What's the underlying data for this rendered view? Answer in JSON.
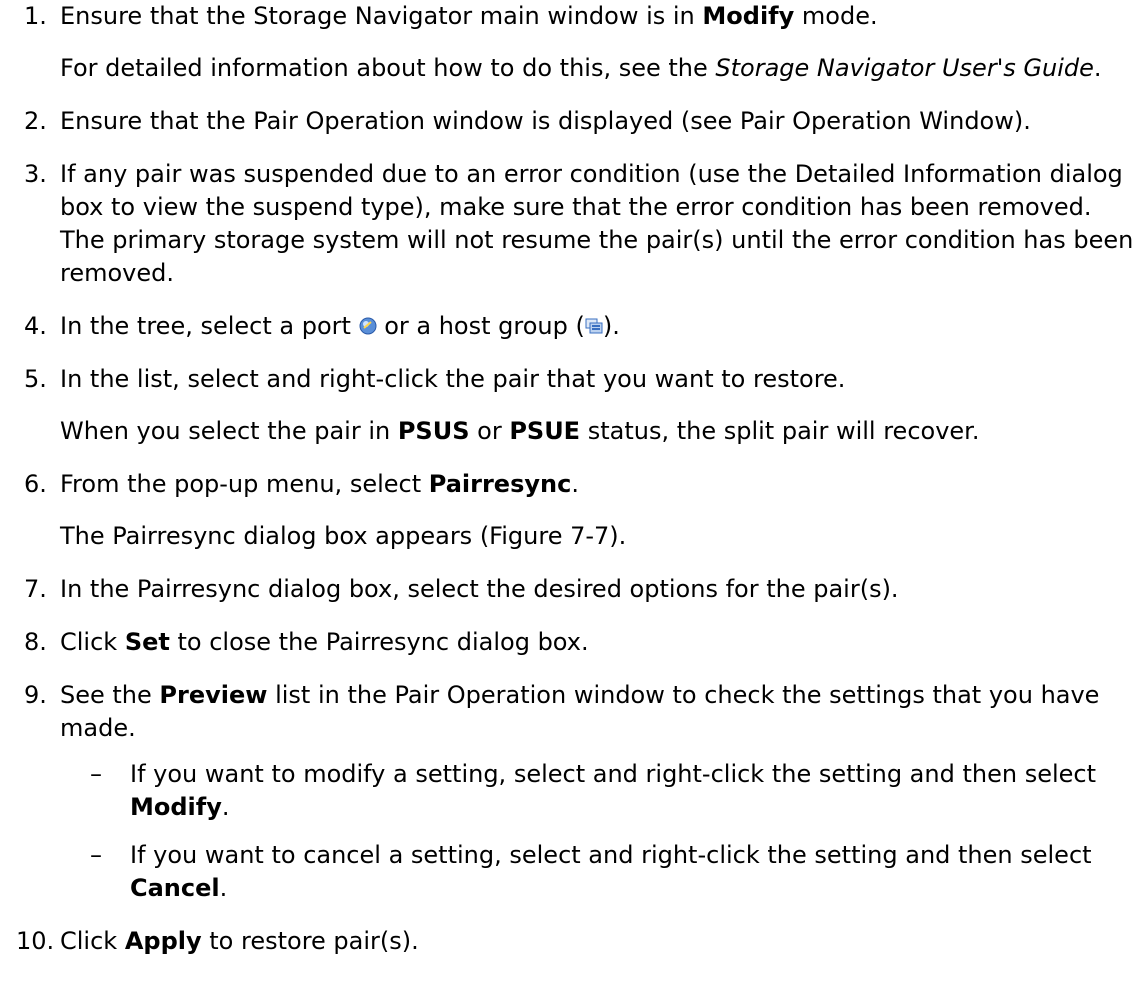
{
  "steps": [
    {
      "n": "1.",
      "text": [
        {
          "t": "Ensure that the Storage Navigator main window is in ",
          "s": "n"
        },
        {
          "t": "Modify",
          "s": "b"
        },
        {
          "t": " mode.",
          "s": "n"
        }
      ],
      "sub": [
        {
          "t": "For detailed information about how to do this, see the ",
          "s": "n"
        },
        {
          "t": "Storage Navigator User's Guide",
          "s": "i"
        },
        {
          "t": ".",
          "s": "n"
        }
      ]
    },
    {
      "n": "2.",
      "text": [
        {
          "t": "Ensure that the Pair Operation window is displayed (see Pair Operation Window).",
          "s": "n"
        }
      ]
    },
    {
      "n": "3.",
      "text": [
        {
          "t": "If any pair was suspended due to an error condition (use the Detailed Information dialog box to view the suspend type), make sure that the error condition has been removed. The primary storage system will not resume the pair(s) until the error condition has been removed.",
          "s": "n"
        }
      ]
    },
    {
      "n": "4.",
      "text": [
        {
          "t": "In the tree, select a port ",
          "s": "n"
        },
        {
          "icon": "port-icon"
        },
        {
          "t": " or a host group (",
          "s": "n"
        },
        {
          "icon": "host-group-icon"
        },
        {
          "t": ").",
          "s": "n"
        }
      ]
    },
    {
      "n": "5.",
      "text": [
        {
          "t": "In the list, select and right-click the pair that you want to restore.",
          "s": "n"
        }
      ],
      "sub": [
        {
          "t": "When you select the pair in ",
          "s": "n"
        },
        {
          "t": "PSUS",
          "s": "b"
        },
        {
          "t": " or ",
          "s": "n"
        },
        {
          "t": "PSUE",
          "s": "b"
        },
        {
          "t": " status, the split pair will recover.",
          "s": "n"
        }
      ]
    },
    {
      "n": "6.",
      "text": [
        {
          "t": "From the pop-up menu, select ",
          "s": "n"
        },
        {
          "t": "Pairresync",
          "s": "b"
        },
        {
          "t": ".",
          "s": "n"
        }
      ],
      "sub": [
        {
          "t": "The Pairresync dialog box appears (Figure 7-7).",
          "s": "n"
        }
      ]
    },
    {
      "n": "7.",
      "text": [
        {
          "t": "In the Pairresync dialog box, select the desired options for the pair(s).",
          "s": "n"
        }
      ]
    },
    {
      "n": "8.",
      "text": [
        {
          "t": "Click ",
          "s": "n"
        },
        {
          "t": "Set",
          "s": "b"
        },
        {
          "t": " to close the Pairresync dialog box.",
          "s": "n"
        }
      ]
    },
    {
      "n": "9.",
      "text": [
        {
          "t": "See the ",
          "s": "n"
        },
        {
          "t": "Preview",
          "s": "b"
        },
        {
          "t": " list in the Pair Operation window to check the settings that you have made.",
          "s": "n"
        }
      ],
      "bullets": [
        [
          {
            "t": "If you want to modify a setting, select and right-click the setting and then select ",
            "s": "n"
          },
          {
            "t": "Modify",
            "s": "b"
          },
          {
            "t": ".",
            "s": "n"
          }
        ],
        [
          {
            "t": "If you want to cancel a setting, select and right-click the setting and then select ",
            "s": "n"
          },
          {
            "t": "Cancel",
            "s": "b"
          },
          {
            "t": ".",
            "s": "n"
          }
        ]
      ]
    },
    {
      "n": "10.",
      "text": [
        {
          "t": "Click ",
          "s": "n"
        },
        {
          "t": "Apply",
          "s": "b"
        },
        {
          "t": " to restore pair(s).",
          "s": "n"
        }
      ]
    }
  ],
  "bullet_dash": "–",
  "colors": {
    "text": "#000000",
    "background": "#ffffff",
    "port_icon": "#5a8fd8",
    "host_group_icon": "#3a6fc0"
  }
}
